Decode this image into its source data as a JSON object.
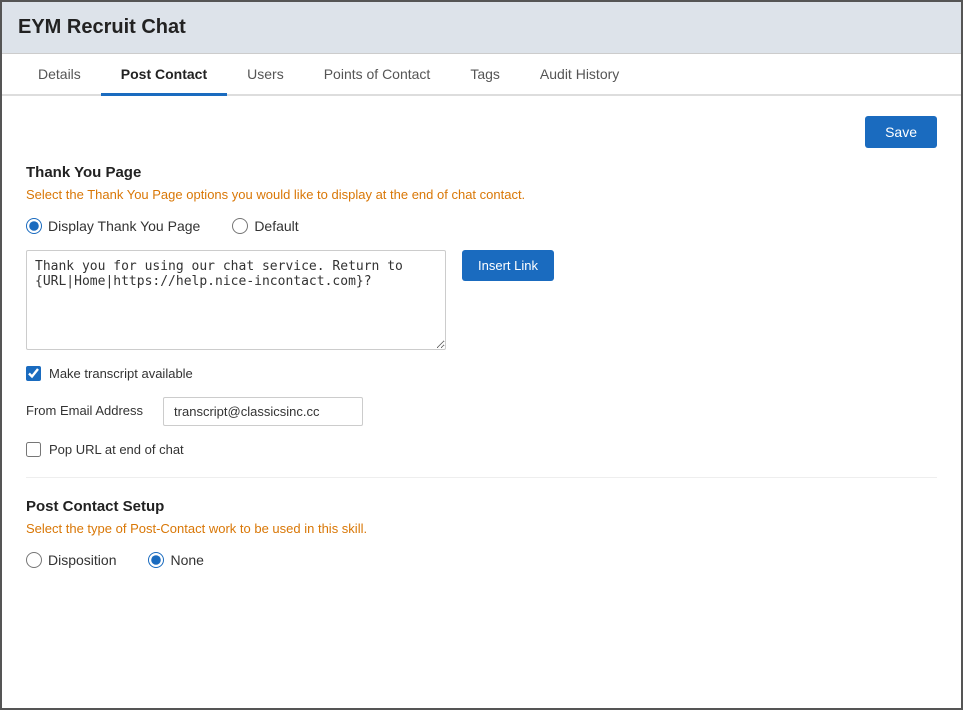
{
  "app": {
    "title": "EYM Recruit Chat"
  },
  "tabs": [
    {
      "id": "details",
      "label": "Details",
      "active": false
    },
    {
      "id": "post-contact",
      "label": "Post Contact",
      "active": true
    },
    {
      "id": "users",
      "label": "Users",
      "active": false
    },
    {
      "id": "points-of-contact",
      "label": "Points of Contact",
      "active": false
    },
    {
      "id": "tags",
      "label": "Tags",
      "active": false
    },
    {
      "id": "audit-history",
      "label": "Audit History",
      "active": false
    }
  ],
  "toolbar": {
    "save_label": "Save"
  },
  "thank_you_page": {
    "section_title": "Thank You Page",
    "section_desc_prefix": "Select the ",
    "section_desc_link": "Thank You Page",
    "section_desc_suffix": " options you would like to display at the end of chat contact.",
    "radio_display": "Display Thank You Page",
    "radio_default": "Default",
    "textarea_value": "Thank you for using our chat service. Return to {URL|Home|https://help.nice-incontact.com}?",
    "insert_link_label": "Insert Link",
    "make_transcript_label": "Make transcript available",
    "from_email_label": "From Email Address",
    "from_email_placeholder": "transcript@classicsinc.cc",
    "from_email_value": "transcript@classicsinc.cc",
    "pop_url_label": "Pop URL at end of chat"
  },
  "post_contact_setup": {
    "section_title": "Post Contact Setup",
    "section_desc_prefix": "Select the type of ",
    "section_desc_link": "Post-Contact",
    "section_desc_suffix": " work to be used in this skill.",
    "radio_disposition": "Disposition",
    "radio_none": "None"
  }
}
